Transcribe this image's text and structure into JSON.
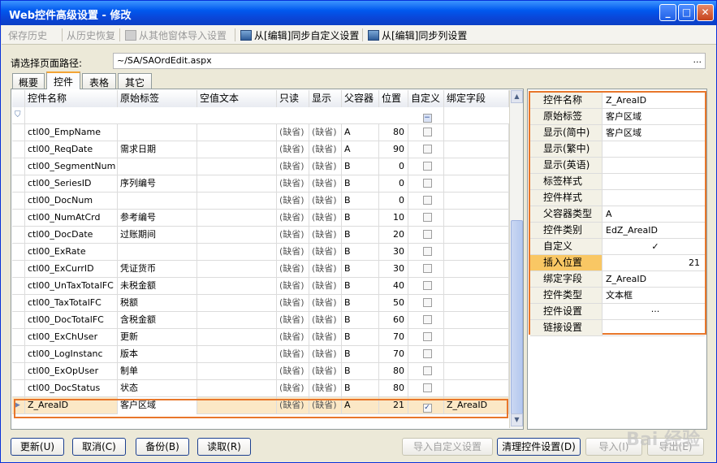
{
  "window": {
    "title": "Web控件高级设置 - 修改",
    "logo": "7"
  },
  "toolbar": {
    "save_history": "保存历史",
    "restore_history": "从历史恢复",
    "import_other": "从其他窗体导入设置",
    "sync_custom": "从[编辑]同步自定义设置",
    "sync_columns": "从[编辑]同步列设置"
  },
  "path": {
    "label": "请选择页面路径:",
    "value": "~/SA/SAOrdEdit.aspx",
    "browse": "..."
  },
  "tabs": [
    "概要",
    "控件",
    "表格",
    "其它"
  ],
  "grid": {
    "headers": [
      "控件名称",
      "原始标签",
      "空值文本",
      "只读",
      "显示",
      "父容器",
      "位置",
      "自定义",
      "绑定字段"
    ],
    "rows": [
      {
        "name": "ctl00_EmpName",
        "label": "",
        "readonly": "(缺省)",
        "show": "(缺省)",
        "parent": "A",
        "pos": "80",
        "custom": false,
        "bind": ""
      },
      {
        "name": "ctl00_ReqDate",
        "label": "需求日期",
        "readonly": "(缺省)",
        "show": "(缺省)",
        "parent": "A",
        "pos": "90",
        "custom": false,
        "bind": ""
      },
      {
        "name": "ctl00_SegmentNum",
        "label": "",
        "readonly": "(缺省)",
        "show": "(缺省)",
        "parent": "B",
        "pos": "0",
        "custom": false,
        "bind": ""
      },
      {
        "name": "ctl00_SeriesID",
        "label": "序列编号",
        "readonly": "(缺省)",
        "show": "(缺省)",
        "parent": "B",
        "pos": "0",
        "custom": false,
        "bind": ""
      },
      {
        "name": "ctl00_DocNum",
        "label": "",
        "readonly": "(缺省)",
        "show": "(缺省)",
        "parent": "B",
        "pos": "0",
        "custom": false,
        "bind": ""
      },
      {
        "name": "ctl00_NumAtCrd",
        "label": "参考编号",
        "readonly": "(缺省)",
        "show": "(缺省)",
        "parent": "B",
        "pos": "10",
        "custom": false,
        "bind": ""
      },
      {
        "name": "ctl00_DocDate",
        "label": "过账期间",
        "readonly": "(缺省)",
        "show": "(缺省)",
        "parent": "B",
        "pos": "20",
        "custom": false,
        "bind": ""
      },
      {
        "name": "ctl00_ExRate",
        "label": "",
        "readonly": "(缺省)",
        "show": "(缺省)",
        "parent": "B",
        "pos": "30",
        "custom": false,
        "bind": ""
      },
      {
        "name": "ctl00_ExCurrID",
        "label": "凭证货币",
        "readonly": "(缺省)",
        "show": "(缺省)",
        "parent": "B",
        "pos": "30",
        "custom": false,
        "bind": ""
      },
      {
        "name": "ctl00_UnTaxTotalFC",
        "label": "未税金额",
        "readonly": "(缺省)",
        "show": "(缺省)",
        "parent": "B",
        "pos": "40",
        "custom": false,
        "bind": ""
      },
      {
        "name": "ctl00_TaxTotalFC",
        "label": "税额",
        "readonly": "(缺省)",
        "show": "(缺省)",
        "parent": "B",
        "pos": "50",
        "custom": false,
        "bind": ""
      },
      {
        "name": "ctl00_DocTotalFC",
        "label": "含税金额",
        "readonly": "(缺省)",
        "show": "(缺省)",
        "parent": "B",
        "pos": "60",
        "custom": false,
        "bind": ""
      },
      {
        "name": "ctl00_ExChUser",
        "label": "更新",
        "readonly": "(缺省)",
        "show": "(缺省)",
        "parent": "B",
        "pos": "70",
        "custom": false,
        "bind": ""
      },
      {
        "name": "ctl00_LogInstanc",
        "label": "版本",
        "readonly": "(缺省)",
        "show": "(缺省)",
        "parent": "B",
        "pos": "70",
        "custom": false,
        "bind": ""
      },
      {
        "name": "ctl00_ExOpUser",
        "label": "制单",
        "readonly": "(缺省)",
        "show": "(缺省)",
        "parent": "B",
        "pos": "80",
        "custom": false,
        "bind": ""
      },
      {
        "name": "ctl00_DocStatus",
        "label": "状态",
        "readonly": "(缺省)",
        "show": "(缺省)",
        "parent": "B",
        "pos": "80",
        "custom": false,
        "bind": ""
      },
      {
        "name": "Z_AreaID",
        "label": "客户区域",
        "readonly": "(缺省)",
        "show": "(缺省)",
        "parent": "A",
        "pos": "21",
        "custom": true,
        "bind": "Z_AreaID"
      }
    ]
  },
  "props": [
    {
      "k": "控件名称",
      "v": "Z_AreaID"
    },
    {
      "k": "原始标签",
      "v": "客户区域"
    },
    {
      "k": "显示(简中)",
      "v": "客户区域"
    },
    {
      "k": "显示(繁中)",
      "v": ""
    },
    {
      "k": "显示(英语)",
      "v": ""
    },
    {
      "k": "标签样式",
      "v": ""
    },
    {
      "k": "控件样式",
      "v": ""
    },
    {
      "k": "父容器类型",
      "v": "A"
    },
    {
      "k": "控件类别",
      "v": "EdZ_AreaID"
    },
    {
      "k": "自定义",
      "v": "✓"
    },
    {
      "k": "插入位置",
      "v": "21"
    },
    {
      "k": "绑定字段",
      "v": "Z_AreaID"
    },
    {
      "k": "控件类型",
      "v": "文本框"
    },
    {
      "k": "控件设置",
      "v": "···"
    },
    {
      "k": "链接设置",
      "v": ""
    }
  ],
  "buttons": {
    "update": "更新(U)",
    "cancel": "取消(C)",
    "backup": "备份(B)",
    "read": "读取(R)",
    "import_custom": "导入自定义设置",
    "clean": "清理控件设置(D)",
    "import": "导入(I)",
    "export": "导出(E)"
  },
  "watermark": "Bai 经验"
}
